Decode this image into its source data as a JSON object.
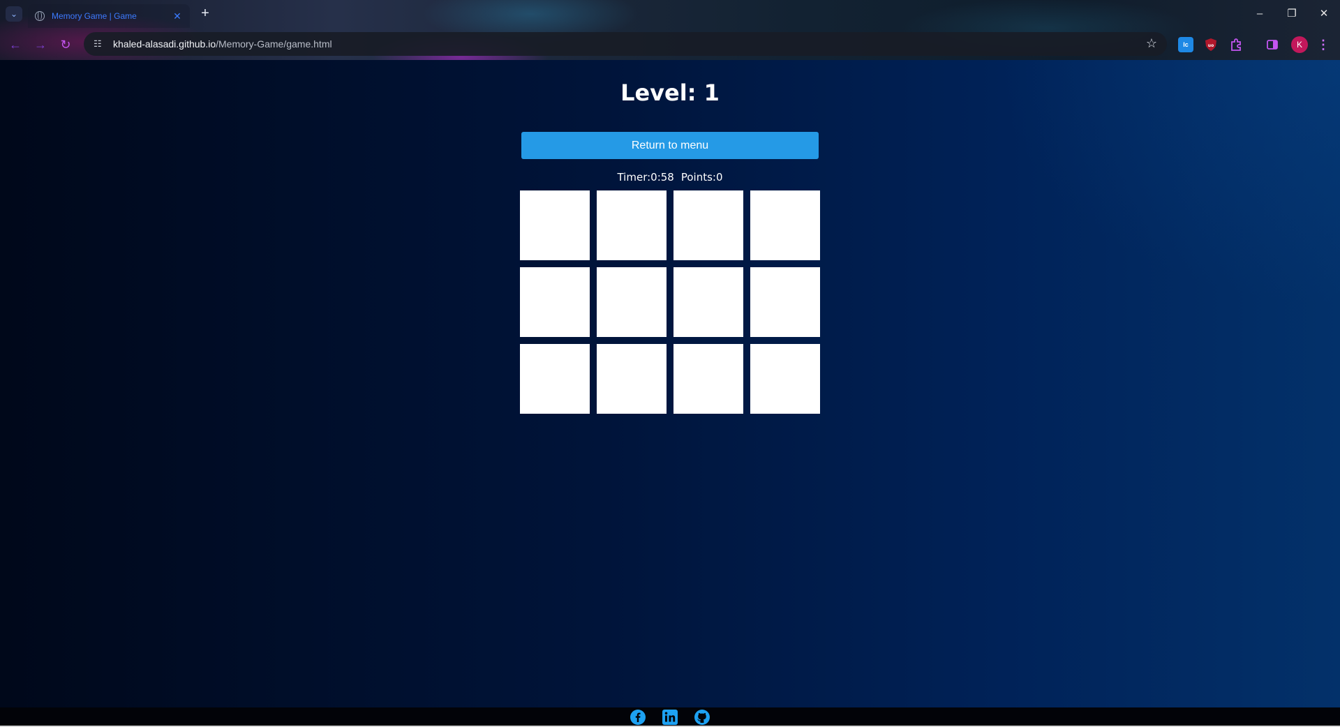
{
  "browser": {
    "tab_title": "Memory Game | Game",
    "tab_close": "✕",
    "new_tab": "+",
    "url_host": "khaled-alasadi.github.io",
    "url_path": "/Memory-Game/game.html",
    "avatar_letter": "K",
    "window_controls": {
      "minimize": "–",
      "restore": "❐",
      "close": "✕"
    }
  },
  "game": {
    "level_label": "Level: 1",
    "menu_button": "Return to menu",
    "timer": "Timer:0:58",
    "points": "Points:0",
    "cards": [
      "",
      "",
      "",
      "",
      "",
      "",
      "",
      "",
      "",
      "",
      "",
      ""
    ]
  },
  "footer": {
    "icons": [
      "facebook-icon",
      "linkedin-icon",
      "github-icon"
    ],
    "icon_color": "#1da1f2"
  },
  "colors": {
    "button": "#259ae6",
    "card": "#ffffff",
    "tab_text": "#3b7cff"
  }
}
